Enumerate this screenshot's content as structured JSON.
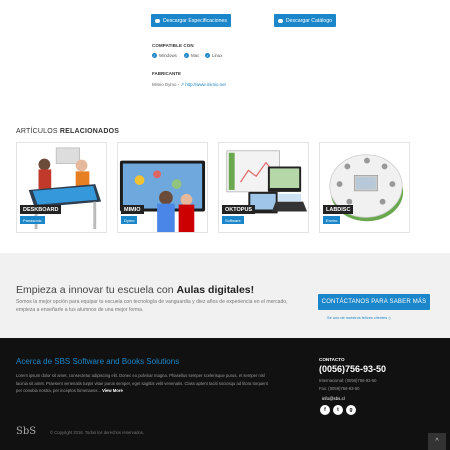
{
  "downloads": {
    "specs_label": "Descargar Especificaciones",
    "catalog_label": "Descargar Catálogo"
  },
  "compat": {
    "label": "COMPATIBLE CON",
    "os": [
      "Windows",
      "Mac",
      "Linux"
    ]
  },
  "manufacturer": {
    "label": "FABRICANTE",
    "name": "Mimio Dymo -",
    "url": "http://www.mimio.net"
  },
  "related": {
    "title_plain": "ARTÍCULOS",
    "title_bold": "RELACIONADOS",
    "items": [
      {
        "name": "DESKBOARD",
        "maker": "Panasonic"
      },
      {
        "name": "MIMIO",
        "maker": "Dymo"
      },
      {
        "name": "OKTOPUS",
        "maker": "Software"
      },
      {
        "name": "LABDISC",
        "maker": "Enviro"
      }
    ]
  },
  "cta": {
    "title_plain": "Empieza a innovar tu escuela con",
    "title_bold": "Aulas digitales!",
    "text": "Somos la mejor opción para equipar tu escuela con tecnología de vanguardia y diez años de experiencia en el mercado, empieza a enseñarle a tus alumnos de una mejor forma.",
    "button": "CONTÁCTANOS PARA SABER MÁS",
    "note": "Se uno de nuestros felices clientes :)"
  },
  "footer": {
    "about_title": "Acerca de SBS Software and Books Solutions",
    "about_text": "Lorem ipsum dolor sit amet, consectetur adipiscing elit. Donec eu pulvinar magna. Phasellus semper scelerisque purus, et semper nisl lacinia sit amet. Praesent venenatis turpis vitae purus semper, eget sagittis velit venenatis. Class aptent taciti sociosqu ad litora torquent per conubia nostra, per inceptos himenaeos...",
    "view_more": "View More",
    "contact_label": "CONTACTO",
    "phone": "(0056)756-93-50",
    "international": "Internacional: (0056)756-93-50",
    "fax": "Fax: (0056)756-93-50",
    "email": "info@sbs.cl",
    "social": [
      "f",
      "t",
      "g"
    ],
    "logo": "SbS",
    "copyright": "© Copyright 2016. Todos los derechos reservados.",
    "to_top": "^"
  },
  "colors": {
    "accent": "#1b86c9",
    "footer_bg": "#111111",
    "cta_bg": "#f1f1f1"
  }
}
